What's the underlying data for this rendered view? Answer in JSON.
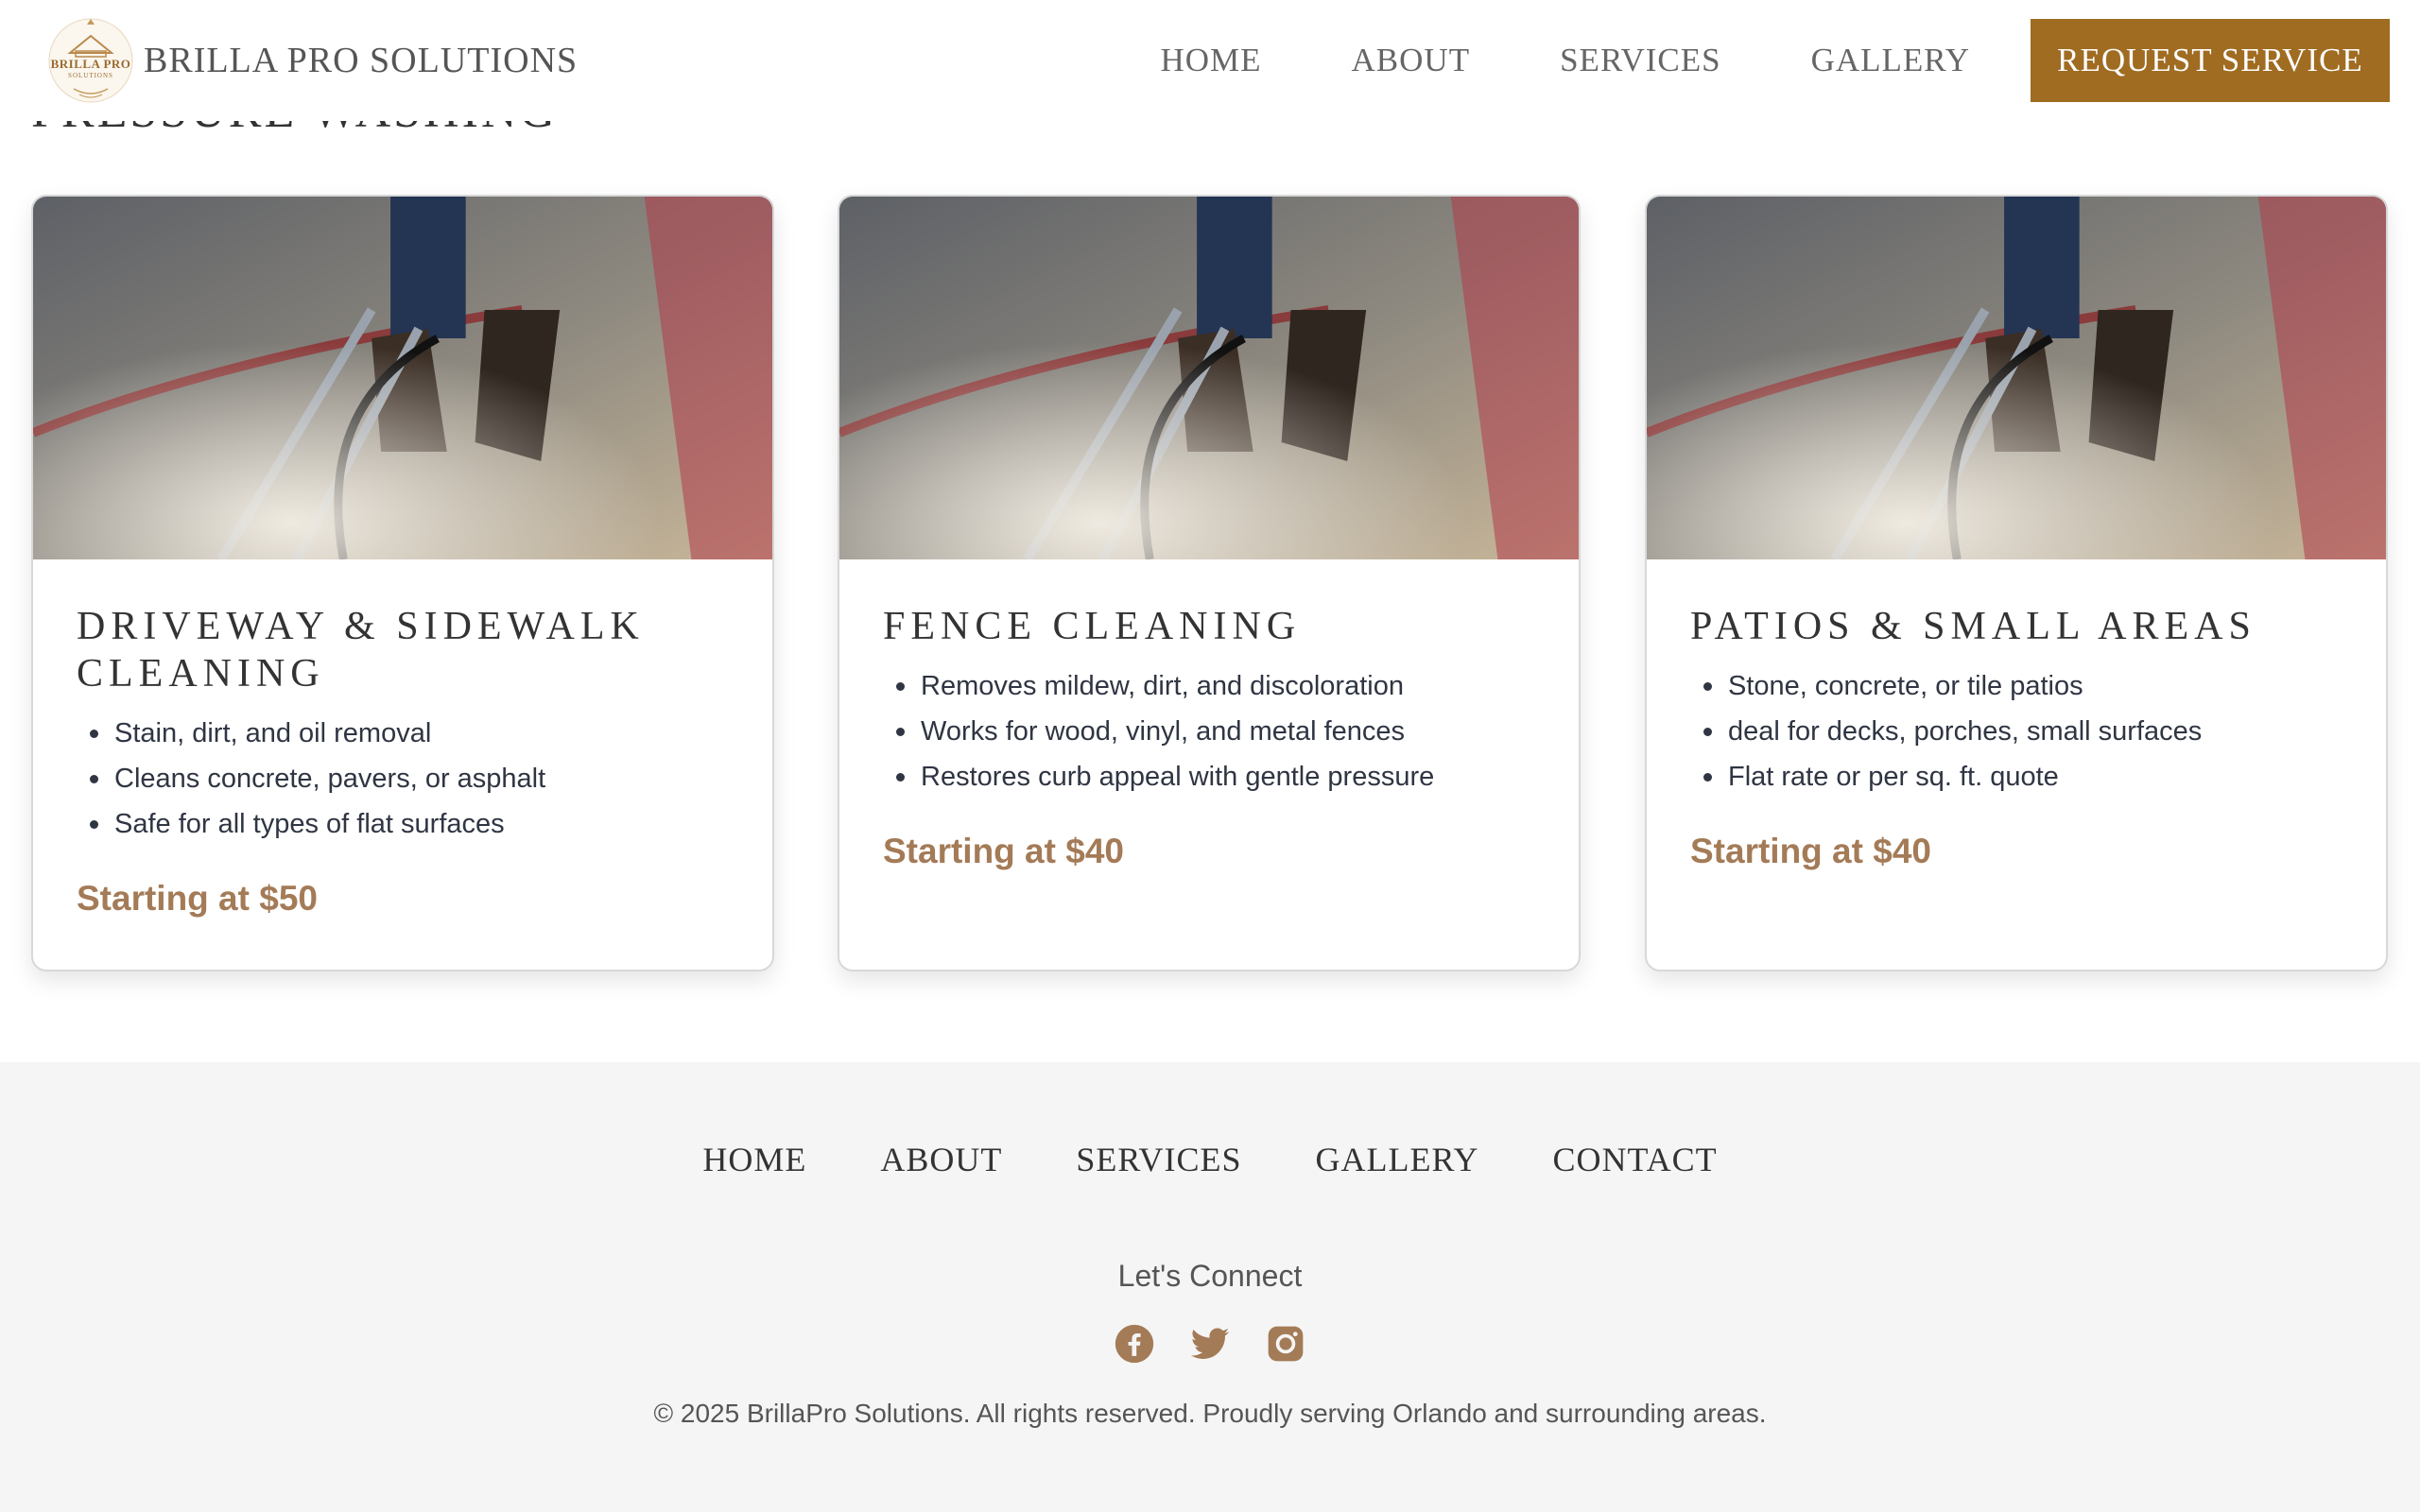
{
  "header": {
    "brand_name": "BRILLA PRO SOLUTIONS",
    "logo_text": "BRILLA PRO",
    "logo_sub": "SOLUTIONS",
    "nav": [
      "HOME",
      "ABOUT",
      "SERVICES",
      "GALLERY"
    ],
    "cta_label": "REQUEST SERVICE"
  },
  "section": {
    "heading": "PRESSURE WASHING"
  },
  "cards": [
    {
      "title": "DRIVEWAY & SIDEWALK CLEANING",
      "bullets": [
        "Stain, dirt, and oil removal",
        "Cleans concrete, pavers, or asphalt",
        "Safe for all types of flat surfaces"
      ],
      "price": "Starting at $50"
    },
    {
      "title": "FENCE CLEANING",
      "bullets": [
        "Removes mildew, dirt, and discoloration",
        "Works for wood, vinyl, and metal fences",
        "Restores curb appeal with gentle pressure"
      ],
      "price": "Starting at $40"
    },
    {
      "title": "PATIOS & SMALL AREAS",
      "bullets": [
        "Stone, concrete, or tile patios",
        "deal for decks, porches, small surfaces",
        "Flat rate or per sq. ft. quote"
      ],
      "price": "Starting at $40"
    }
  ],
  "footer": {
    "nav": [
      "HOME",
      "ABOUT",
      "SERVICES",
      "GALLERY",
      "CONTACT"
    ],
    "connect_label": "Let's Connect",
    "socials": [
      "facebook-icon",
      "twitter-icon",
      "instagram-icon"
    ],
    "copyright": "© 2025 BrillaPro Solutions. All rights reserved. Proudly serving Orlando and surrounding areas."
  },
  "colors": {
    "accent": "#a06c22",
    "price": "#a47b57",
    "footer_bg": "#f5f5f5"
  }
}
